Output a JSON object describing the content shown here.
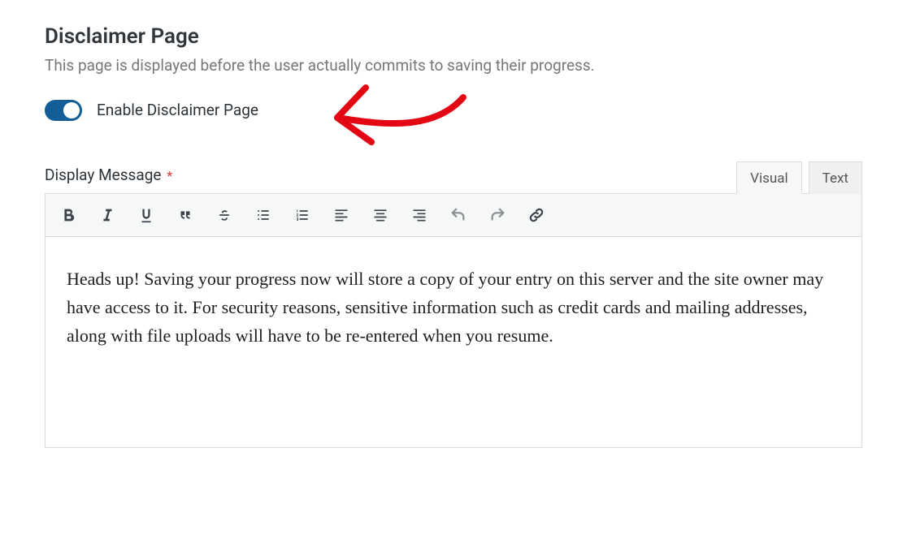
{
  "section": {
    "title": "Disclaimer Page",
    "description": "This page is displayed before the user actually commits to saving their progress."
  },
  "toggle": {
    "label": "Enable Disclaimer Page",
    "enabled": true
  },
  "field": {
    "label": "Display Message",
    "required_marker": "*"
  },
  "editor": {
    "tabs": {
      "visual": "Visual",
      "text": "Text"
    },
    "content": "Heads up! Saving your progress now will store a copy of your entry on this server and the site owner may have access to it. For security reasons, sensitive information such as credit cards and mailing addresses, along with file uploads will have to be re-entered when you resume."
  },
  "colors": {
    "toggle_on": "#135e96",
    "required": "#d63638",
    "annotation": "#e30613"
  }
}
